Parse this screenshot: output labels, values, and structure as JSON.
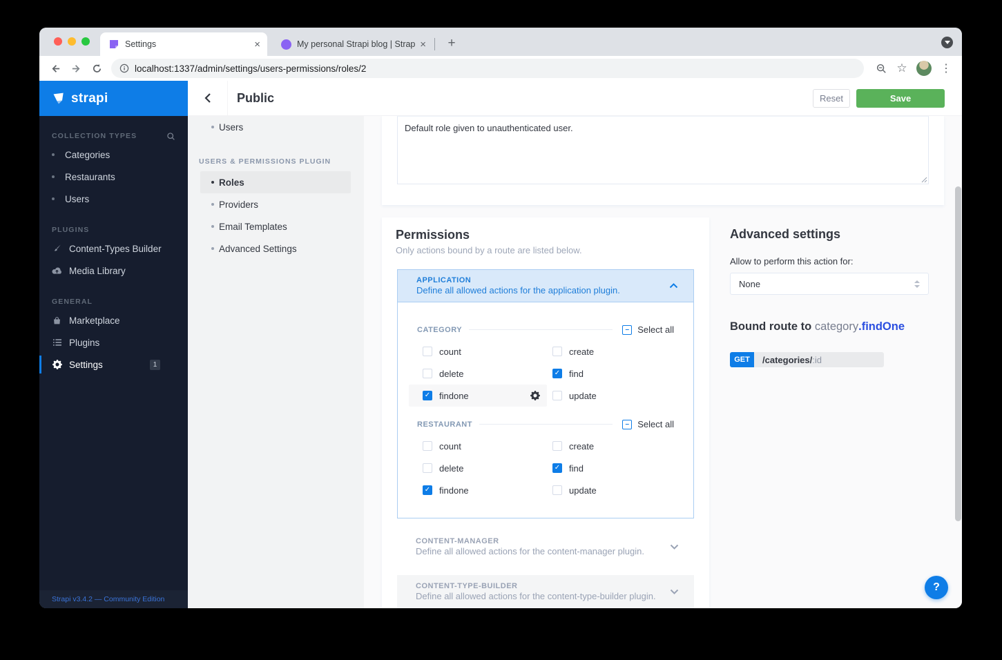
{
  "colors": {
    "accent_blue": "#0e7de7",
    "save_green": "#5ab25a",
    "sidebar_dark": "#161d2e",
    "accordion_blue_bg": "#d9e9fa",
    "accordion_blue_text": "#1f7ed9",
    "bound_action_blue": "#2b4fe0"
  },
  "browser": {
    "tabs": [
      {
        "title": "Settings",
        "close": "×"
      },
      {
        "title": "My personal Strapi blog | Strap",
        "close": "×"
      }
    ],
    "new_tab": "+",
    "url": "localhost:1337/admin/settings/users-permissions/roles/2",
    "kebab": "⋮",
    "star": "☆"
  },
  "sidebar": {
    "logo": "strapi",
    "sections": [
      {
        "title": "COLLECTION TYPES",
        "items": [
          {
            "label": "Categories"
          },
          {
            "label": "Restaurants"
          },
          {
            "label": "Users"
          }
        ]
      },
      {
        "title": "PLUGINS",
        "items": [
          {
            "label": "Content-Types Builder",
            "icon": "brush-icon"
          },
          {
            "label": "Media Library",
            "icon": "cloud-upload-icon"
          }
        ]
      },
      {
        "title": "GENERAL",
        "items": [
          {
            "label": "Marketplace",
            "icon": "bag-icon"
          },
          {
            "label": "Plugins",
            "icon": "list-icon"
          },
          {
            "label": "Settings",
            "icon": "gear-icon",
            "active": true,
            "badge": "1"
          }
        ]
      }
    ],
    "footer": "Strapi v3.4.2 — Community Edition"
  },
  "header": {
    "title": "Public",
    "reset_label": "Reset",
    "save_label": "Save"
  },
  "subnav": {
    "top_items": [
      {
        "label": "Users"
      }
    ],
    "section_title": "USERS & PERMISSIONS PLUGIN",
    "items": [
      {
        "label": "Roles",
        "active": true
      },
      {
        "label": "Providers"
      },
      {
        "label": "Email Templates"
      },
      {
        "label": "Advanced Settings"
      }
    ]
  },
  "description": {
    "value": "Default role given to unauthenticated user."
  },
  "permissions": {
    "title": "Permissions",
    "subtitle": "Only actions bound by a route are listed below.",
    "application": {
      "title": "APPLICATION",
      "description": "Define all allowed actions for the application plugin.",
      "groups": [
        {
          "name": "CATEGORY",
          "select_all": "Select all",
          "actions": [
            {
              "label": "count",
              "checked": false
            },
            {
              "label": "create",
              "checked": false
            },
            {
              "label": "delete",
              "checked": false
            },
            {
              "label": "find",
              "checked": true
            },
            {
              "label": "findone",
              "checked": true,
              "selected": true
            },
            {
              "label": "update",
              "checked": false
            }
          ]
        },
        {
          "name": "RESTAURANT",
          "select_all": "Select all",
          "actions": [
            {
              "label": "count",
              "checked": false
            },
            {
              "label": "create",
              "checked": false
            },
            {
              "label": "delete",
              "checked": false
            },
            {
              "label": "find",
              "checked": true
            },
            {
              "label": "findone",
              "checked": true
            },
            {
              "label": "update",
              "checked": false
            }
          ]
        }
      ]
    },
    "collapsed": [
      {
        "title": "CONTENT-MANAGER",
        "description": "Define all allowed actions for the content-manager plugin."
      },
      {
        "title": "CONTENT-TYPE-BUILDER",
        "description": "Define all allowed actions for the content-type-builder plugin."
      }
    ]
  },
  "advanced": {
    "title": "Advanced settings",
    "label": "Allow to perform this action for:",
    "select_value": "None",
    "bound_route_prefix": "Bound route to",
    "bound_route_target": " category",
    "bound_route_action": ".findOne",
    "route_method": "GET",
    "route_path": "/categories/",
    "route_param": ":id"
  },
  "help": "?"
}
